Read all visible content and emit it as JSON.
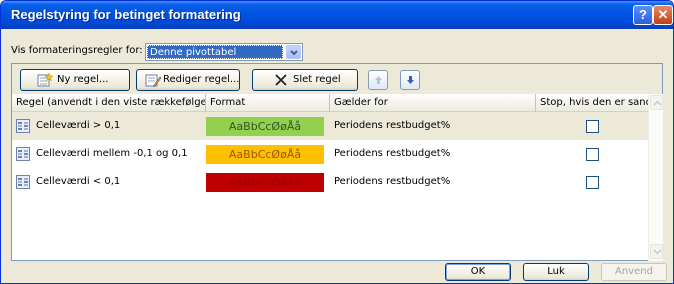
{
  "window": {
    "title": "Regelstyring for betinget formatering"
  },
  "titlebar_buttons": {
    "help": "?",
    "close": "✕"
  },
  "show_rules": {
    "label": "Vis formateringsregler for:",
    "selected": "Denne pivottabel"
  },
  "toolbar": {
    "new_rule": "Ny regel...",
    "edit_rule": "Rediger regel...",
    "delete_rule": "Slet regel"
  },
  "columns": {
    "rule": "Regel (anvendt i den viste rækkefølge)",
    "format": "Format",
    "applies_to": "Gælder for",
    "stop_if_true": "Stop, hvis den er sand"
  },
  "rules": [
    {
      "rule": "Celleværdi > 0,1",
      "format_preview": "AaBbCcØøÅå",
      "format_bg": "#92d050",
      "format_fg": "#375623",
      "applies_to": "Periodens restbudget%",
      "stop": false,
      "selected": true
    },
    {
      "rule": "Celleværdi mellem -0,1 og 0,1",
      "format_preview": "AaBbCcØøÅå",
      "format_bg": "#ffc000",
      "format_fg": "#9c5700",
      "applies_to": "Periodens restbudget%",
      "stop": false,
      "selected": false
    },
    {
      "rule": "Celleværdi < 0,1",
      "format_preview": "AaBbCcØøÅå",
      "format_bg": "#c00000",
      "format_fg": "#9c0006",
      "applies_to": "Periodens restbudget%",
      "stop": false,
      "selected": false
    }
  ],
  "buttons": {
    "ok": "OK",
    "close": "Luk",
    "apply": "Anvend"
  },
  "colors": {
    "titlebar": "#0054e3",
    "selection": "#316ac5",
    "dialog_bg": "#ece9d8"
  }
}
